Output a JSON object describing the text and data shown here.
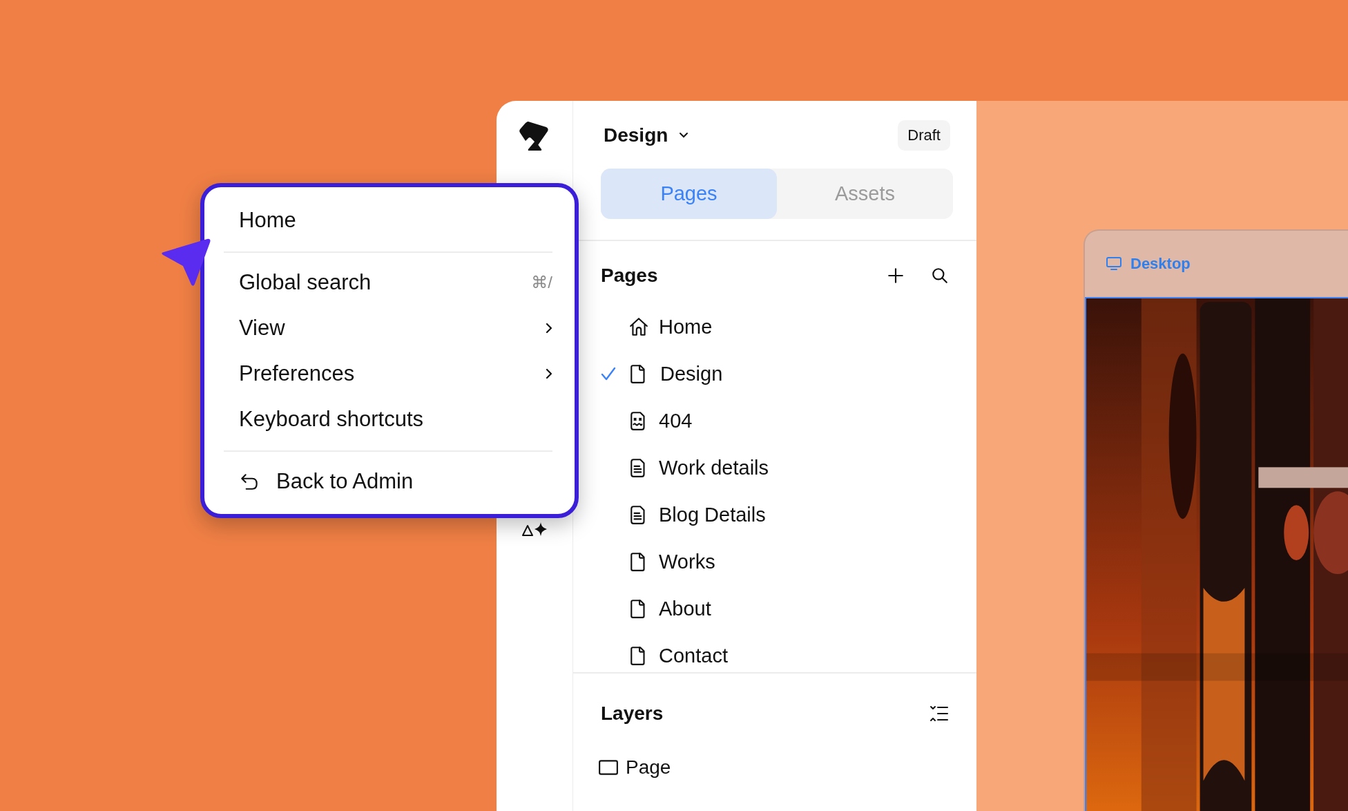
{
  "editor": {
    "page_title": "Design",
    "status": "Draft"
  },
  "tabs": [
    {
      "label": "Pages",
      "selected": true
    },
    {
      "label": "Assets",
      "selected": false
    }
  ],
  "pages": {
    "heading": "Pages",
    "items": [
      {
        "label": "Home",
        "kind": "home",
        "selected": false
      },
      {
        "label": "Design",
        "kind": "page",
        "selected": true
      },
      {
        "label": "404",
        "kind": "error",
        "selected": false
      },
      {
        "label": "Work details",
        "kind": "text",
        "selected": false
      },
      {
        "label": "Blog Details",
        "kind": "text",
        "selected": false
      },
      {
        "label": "Works",
        "kind": "page",
        "selected": false
      },
      {
        "label": "About",
        "kind": "page",
        "selected": false
      },
      {
        "label": "Contact",
        "kind": "page",
        "selected": false
      }
    ]
  },
  "layers": {
    "heading": "Layers",
    "items": [
      {
        "label": "Page",
        "kind": "frame"
      }
    ]
  },
  "canvas": {
    "frame_label": "Desktop"
  },
  "menu": {
    "sections": [
      [
        {
          "label": "Home",
          "submenu": false
        }
      ],
      [
        {
          "label": "Global search",
          "shortcut": "⌘/",
          "submenu": false
        },
        {
          "label": "View",
          "submenu": true
        },
        {
          "label": "Preferences",
          "submenu": true
        },
        {
          "label": "Keyboard shortcuts",
          "submenu": false
        }
      ],
      [
        {
          "label": "Back to Admin",
          "kind": "back",
          "submenu": false
        }
      ]
    ]
  }
}
